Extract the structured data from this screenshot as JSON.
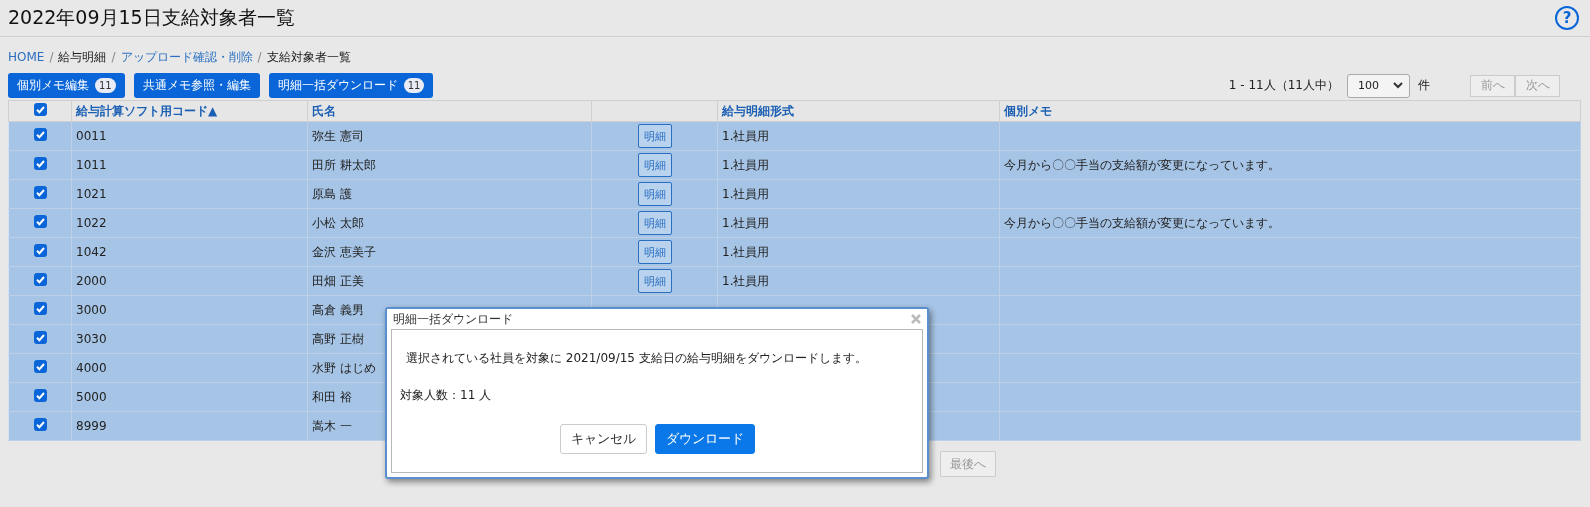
{
  "page_title": "2022年09月15日支給対象者一覧",
  "help_icon": "?",
  "breadcrumb": [
    {
      "label": "HOME",
      "link": true
    },
    {
      "label": "/",
      "kind": "separator"
    },
    {
      "label": "給与明細",
      "link": false
    },
    {
      "label": "/",
      "kind": "separator"
    },
    {
      "label": "アップロード確認・削除",
      "link": true
    },
    {
      "label": "/",
      "kind": "separator"
    },
    {
      "label": "支給対象者一覧",
      "link": false
    }
  ],
  "toolbar_buttons": [
    {
      "label": "個別メモ編集",
      "badge": "11"
    },
    {
      "label": "共通メモ参照・編集"
    },
    {
      "label": "明細一括ダウンロード",
      "badge": "11"
    }
  ],
  "paging": {
    "summary": "1 - 11人（11人中）",
    "page_size": "100",
    "unit": "件",
    "buttons": [
      {
        "label": "前へ",
        "disabled": true
      },
      {
        "label": "次へ",
        "disabled": true
      }
    ]
  },
  "table": {
    "select_all_checked": true,
    "columns": [
      "給与計算ソフト用コード▲",
      "氏名",
      "",
      "給与明細形式",
      "個別メモ"
    ],
    "rows": [
      {
        "code": "0011",
        "name": "弥生 憲司",
        "detail": "明細",
        "format": "1.社員用",
        "checked": true,
        "selected": true
      },
      {
        "code": "1011",
        "name": "田所 耕太郎",
        "detail": "明細",
        "format": "1.社員用",
        "memo": "今月から〇〇手当の支給額が変更になっています。",
        "checked": true,
        "selected": true
      },
      {
        "code": "1021",
        "name": "原島 護",
        "detail": "明細",
        "format": "1.社員用",
        "checked": true,
        "selected": true
      },
      {
        "code": "1022",
        "name": "小松 太郎",
        "detail": "明細",
        "format": "1.社員用",
        "memo": "今月から〇〇手当の支給額が変更になっています。",
        "checked": true,
        "selected": true
      },
      {
        "code": "1042",
        "name": "金沢 恵美子",
        "detail": "明細",
        "format": "1.社員用",
        "checked": true,
        "selected": true
      },
      {
        "code": "2000",
        "name": "田畑 正美",
        "detail": "明細",
        "format": "1.社員用",
        "checked": true,
        "selected": true
      },
      {
        "code": "3000",
        "name": "高倉 義男",
        "checked": true,
        "selected": true
      },
      {
        "code": "3030",
        "name": "高野 正樹",
        "checked": true,
        "selected": true
      },
      {
        "code": "4000",
        "name": "水野 はじめ",
        "checked": true,
        "selected": true
      },
      {
        "code": "5000",
        "name": "和田 裕",
        "checked": true,
        "selected": true
      },
      {
        "code": "8999",
        "name": "嵩木 一",
        "checked": true,
        "selected": true
      }
    ]
  },
  "bottom_pager": [
    {
      "label": "最後へ",
      "disabled": true
    }
  ],
  "dialog": {
    "title": "明細一括ダウンロード",
    "message": "選択されている社員を対象に 2021/09/15 支給日の給与明細をダウンロードします。",
    "count": "対象人数：11 人",
    "buttons": [
      {
        "label": "キャンセル",
        "kind": "secondary"
      },
      {
        "label": "ダウンロード",
        "kind": "primary"
      }
    ]
  }
}
